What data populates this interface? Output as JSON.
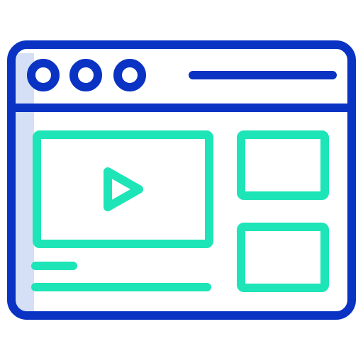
{
  "icon": {
    "name": "video-website-icon",
    "colors": {
      "frame": "#0a33c4",
      "content": "#1de5b8",
      "shadow": "#d5dff5",
      "background": "#ffffff"
    }
  }
}
